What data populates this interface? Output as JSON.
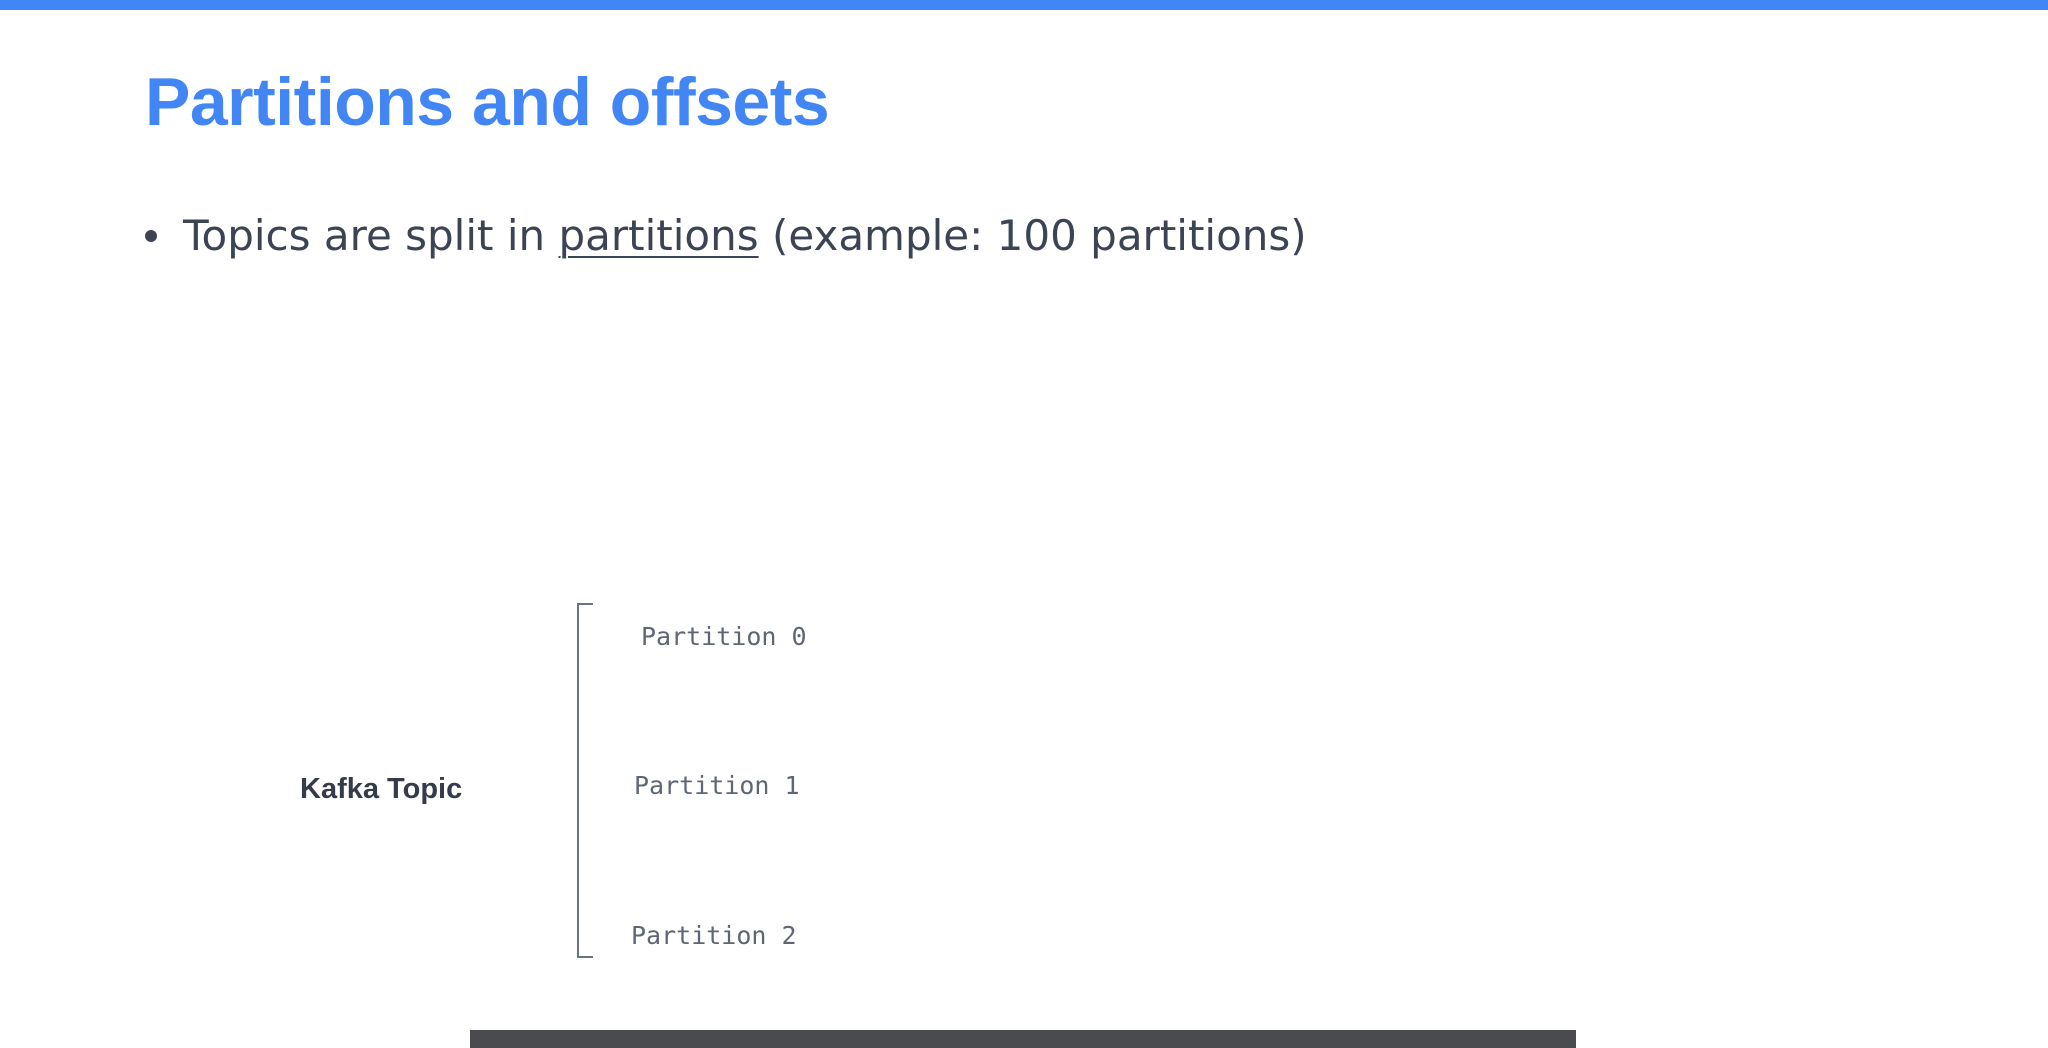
{
  "slide": {
    "title": "Partitions and offsets",
    "accent_color": "#4285f4",
    "text_color": "#3c4353"
  },
  "bullet": {
    "prefix": "Topics are split in ",
    "link_text": "partitions",
    "suffix": " (example: 100 partitions)"
  },
  "diagram": {
    "topic_label": "Kafka Topic",
    "partitions": [
      {
        "label": "Partition 0"
      },
      {
        "label": "Partition 1"
      },
      {
        "label": "Partition 2"
      }
    ]
  }
}
